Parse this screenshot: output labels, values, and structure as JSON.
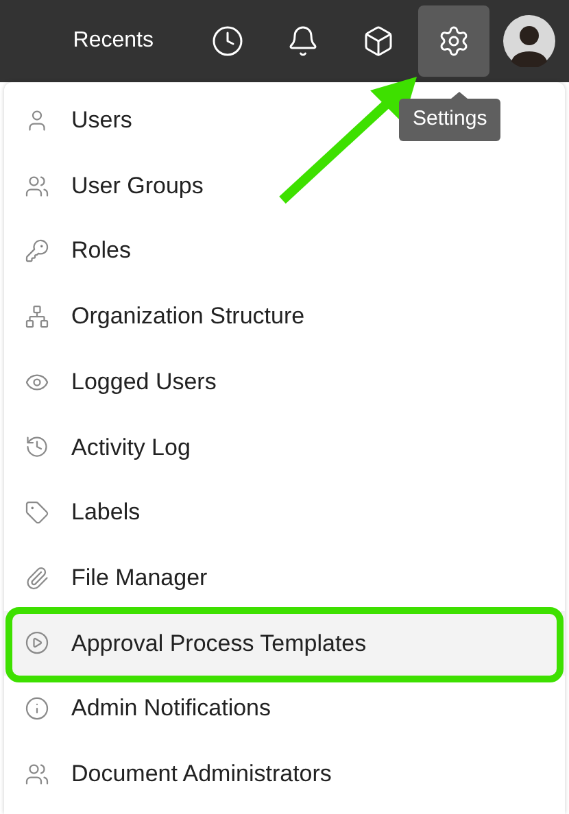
{
  "header": {
    "recents": "Recents",
    "buttons": [
      {
        "kind": "clock",
        "selected": false
      },
      {
        "kind": "bell",
        "selected": false
      },
      {
        "kind": "box",
        "selected": false
      },
      {
        "kind": "gear",
        "selected": true
      }
    ],
    "tooltip": "Settings"
  },
  "menu": [
    {
      "label": "Users",
      "kind": "user",
      "selected": false
    },
    {
      "label": "User Groups",
      "kind": "users",
      "selected": false
    },
    {
      "label": "Roles",
      "kind": "key",
      "selected": false
    },
    {
      "label": "Organization Structure",
      "kind": "org",
      "selected": false
    },
    {
      "label": "Logged Users",
      "kind": "eye",
      "selected": false
    },
    {
      "label": "Activity Log",
      "kind": "history",
      "selected": false
    },
    {
      "label": "Labels",
      "kind": "tag",
      "selected": false
    },
    {
      "label": "File Manager",
      "kind": "clip",
      "selected": false
    },
    {
      "label": "Approval Process Templates",
      "kind": "play",
      "selected": true
    },
    {
      "label": "Admin Notifications",
      "kind": "info",
      "selected": false
    },
    {
      "label": "Document Administrators",
      "kind": "users",
      "selected": false
    }
  ]
}
